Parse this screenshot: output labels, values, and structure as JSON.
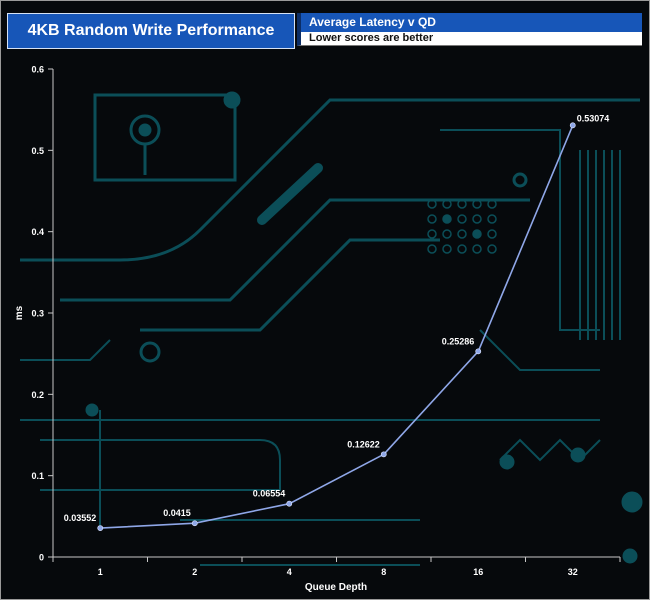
{
  "header": {
    "title": "4KB Random Write Performance",
    "subtitle": "Average Latency v QD",
    "note": "Lower scores are better"
  },
  "colors": {
    "background": "#06090c",
    "circuit": "#0d5b66",
    "line": "#8fa7e8",
    "text": "#ffffff",
    "title_bg": "#1756b8"
  },
  "chart_data": {
    "type": "line",
    "categories": [
      "1",
      "2",
      "4",
      "8",
      "16",
      "32"
    ],
    "series": [
      {
        "values": [
          0.03552,
          0.0415,
          0.06554,
          0.12622,
          0.25286,
          0.53074
        ]
      }
    ],
    "data_labels": [
      "0.03552",
      "0.0415",
      "0.06554",
      "0.12622",
      "0.25286",
      "0.53074"
    ],
    "xlabel": "Queue Depth",
    "ylabel": "ms",
    "ylim": [
      0,
      0.6
    ],
    "yticks": [
      0,
      0.1,
      0.2,
      0.3,
      0.4,
      0.5,
      0.6
    ],
    "ytick_labels": [
      "0",
      "0.1",
      "0.2",
      "0.3",
      "0.4",
      "0.5",
      "0.6"
    ],
    "grid": false,
    "legend": "none"
  }
}
